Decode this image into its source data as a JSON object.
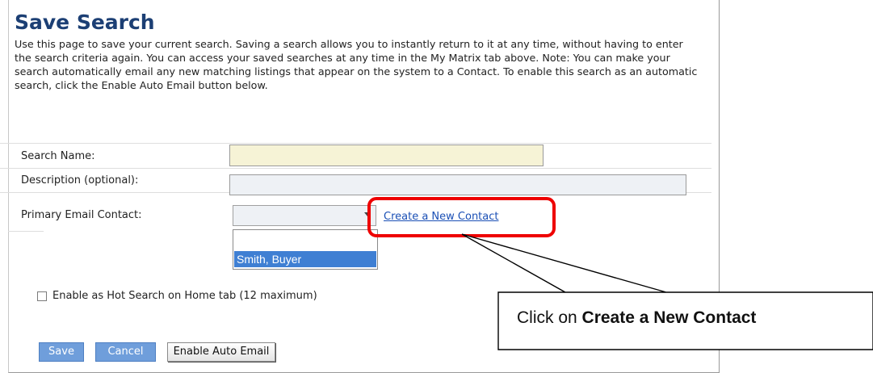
{
  "page": {
    "title": "Save Search",
    "intro": "Use this page to save your current search. Saving a search allows you to instantly return to it at any time, without having to enter the search criteria again. You can access your saved searches at any time in the My Matrix tab above. Note: You can make your search automatically email any new matching listings that appear on the system to a Contact. To enable this search as an automatic search, click the Enable Auto Email button below."
  },
  "form": {
    "search_name_label": "Search Name:",
    "search_name_value": "",
    "description_label": "Description (optional):",
    "description_value": "",
    "primary_email_label": "Primary Email Contact:",
    "primary_email_selected": "",
    "dropdown_options": [
      "",
      "Smith, Buyer"
    ],
    "create_contact_link": "Create a New Contact",
    "hot_search_label": "Enable as Hot Search on Home tab (12 maximum)",
    "hot_search_checked": false
  },
  "buttons": {
    "save": "Save",
    "cancel": "Cancel",
    "enable_auto_email": "Enable Auto Email"
  },
  "callout": {
    "prefix": "Click on ",
    "bold": "Create a New Contact"
  },
  "colors": {
    "title": "#1c3f74",
    "link": "#1a4fb5",
    "highlight_border": "#ee0000",
    "selected_option": "#3f7fd3",
    "primary_button": "#6f9edb",
    "search_name_field": "#f6f3d6",
    "description_field": "#eef1f5"
  }
}
